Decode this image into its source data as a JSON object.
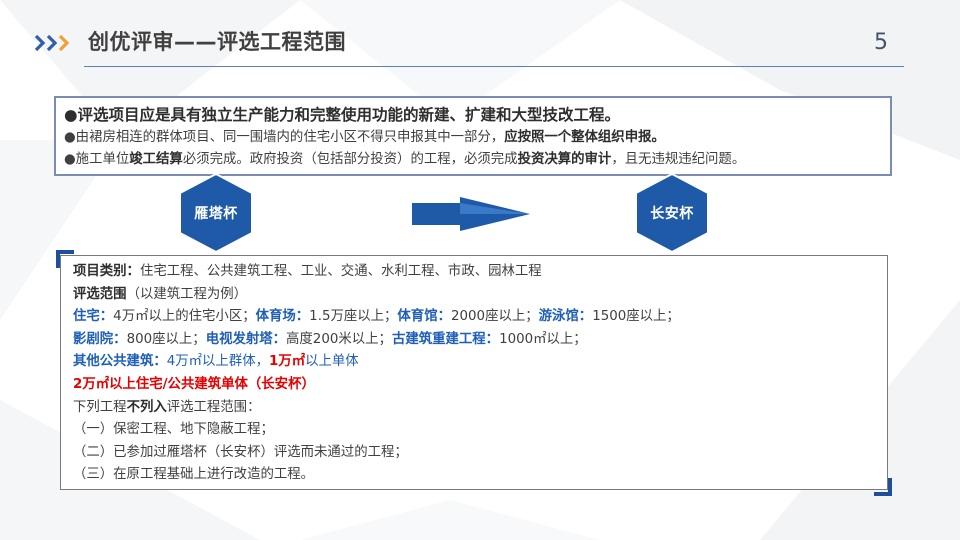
{
  "header": {
    "title": "创优评审——评选工程范围",
    "page_number": "5"
  },
  "colors": {
    "accent_blue": "#1F5FB8",
    "hex_fill": "#1E5AA8",
    "chevron_orange": "#F0A22E",
    "emphasis_red": "#E60000"
  },
  "summary": {
    "line1": "●评选项目应是具有独立生产能力和完整使用功能的新建、扩建和大型技改工程。",
    "line2_a": "●由裙房相连的群体项目、同一围墙内的住宅小区不得只申报其中一部分，",
    "line2_b": "应按照一个整体组织申报。",
    "line3_a": "●施工单位",
    "line3_b": "竣工结算",
    "line3_c": "必须完成。政府投资（包括部分投资）的工程，必须完成",
    "line3_d": "投资决算的审计",
    "line3_e": "，且无违规违纪问题。"
  },
  "flow": {
    "left_award": "雁塔杯",
    "right_award": "长安杯",
    "arrow_icon": "arrow-right-icon"
  },
  "details": {
    "category_label": "项目类别：",
    "category_text": "住宅工程、公共建筑工程、工业、交通、水利工程、市政、园林工程",
    "scope_label": "评选范围",
    "scope_text": "（以建筑工程为例）",
    "residential_label": "住宅：",
    "residential_text": "4万㎡以上的住宅小区；",
    "stadium_label": "体育场：",
    "stadium_text": "1.5万座以上；",
    "gym_label": "体育馆：",
    "gym_text": "2000座以上；",
    "pool_label": "游泳馆：",
    "pool_text": "1500座以上；",
    "theater_label": "影剧院：",
    "theater_text": "800座以上；",
    "tv_label": "电视发射塔：",
    "tv_text": "高度200米以上；",
    "ancient_label": "古建筑重建工程：",
    "ancient_text": "1000㎡以上；",
    "other_label": "其他公共建筑：",
    "other_text": "4万㎡以上群体，",
    "other_red": "1万㎡",
    "other_tail": "以上单体",
    "changan_line": "2万㎡以上住宅/公共建筑单体（长安杯）",
    "exclude_a": "下列工程",
    "exclude_b": "不列入",
    "exclude_c": "评选工程范围：",
    "exclude_1": "（一）保密工程、地下隐蔽工程；",
    "exclude_2": "（二）已参加过雁塔杯（长安杯）评选而未通过的工程；",
    "exclude_3": "（三）在原工程基础上进行改造的工程。"
  }
}
